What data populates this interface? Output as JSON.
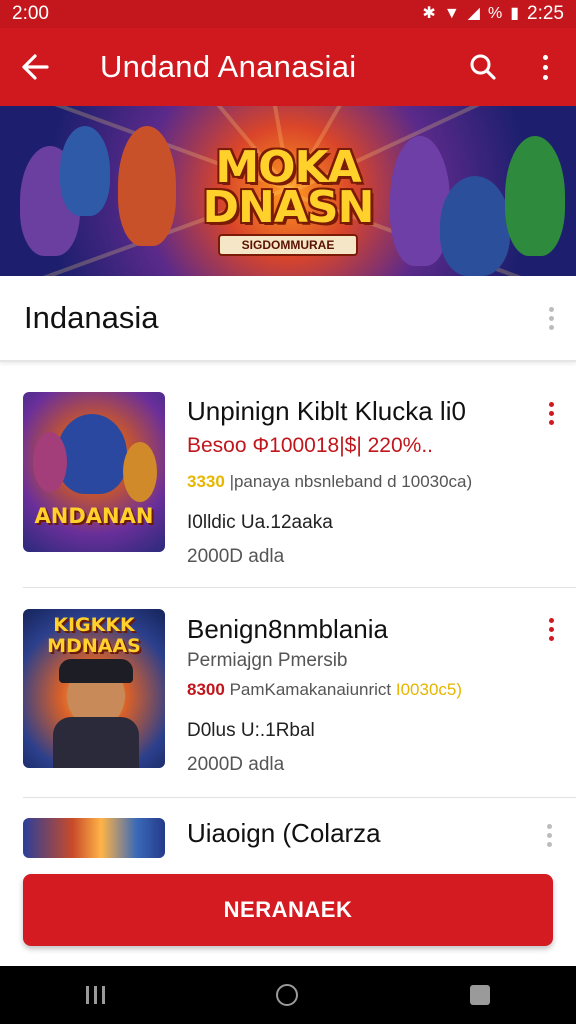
{
  "status_bar": {
    "time_left": "2:00",
    "time_right": "2:25",
    "battery_label": "%"
  },
  "app_bar": {
    "title": "Undand Ananasiai"
  },
  "banner": {
    "title_line1": "MOKA",
    "title_line2": "DNASN",
    "subtitle": "SIGDOMMURAE"
  },
  "section": {
    "title": "Indanasia"
  },
  "items": [
    {
      "title": "Unpinign Kiblt Klucka li0",
      "line1": "Besoo Φ100018|$| 220%..",
      "rating": "3330",
      "line2": "|panaya nbsnleband d 10030ca)",
      "line3": "I0lldic Ua.12aaka",
      "line4": "2000D adla",
      "thumb_text": "ANDANAN"
    },
    {
      "title": "Benign8nmblania",
      "line1": "Permiajgn Pmersib",
      "rating": "8300",
      "line2": "PamKamakanaiunrict",
      "line2b": "I0030c5)",
      "line3": "D0lus U:.1Rbal",
      "line4": "2000D adla",
      "thumb_text": "KIGKKK MDNAAS"
    },
    {
      "title": "Uiaoign (Colarza"
    }
  ],
  "primary_button": {
    "label": "NERANAEK"
  },
  "colors": {
    "brand_red": "#d0191e",
    "rating_gold": "#e6b600"
  }
}
